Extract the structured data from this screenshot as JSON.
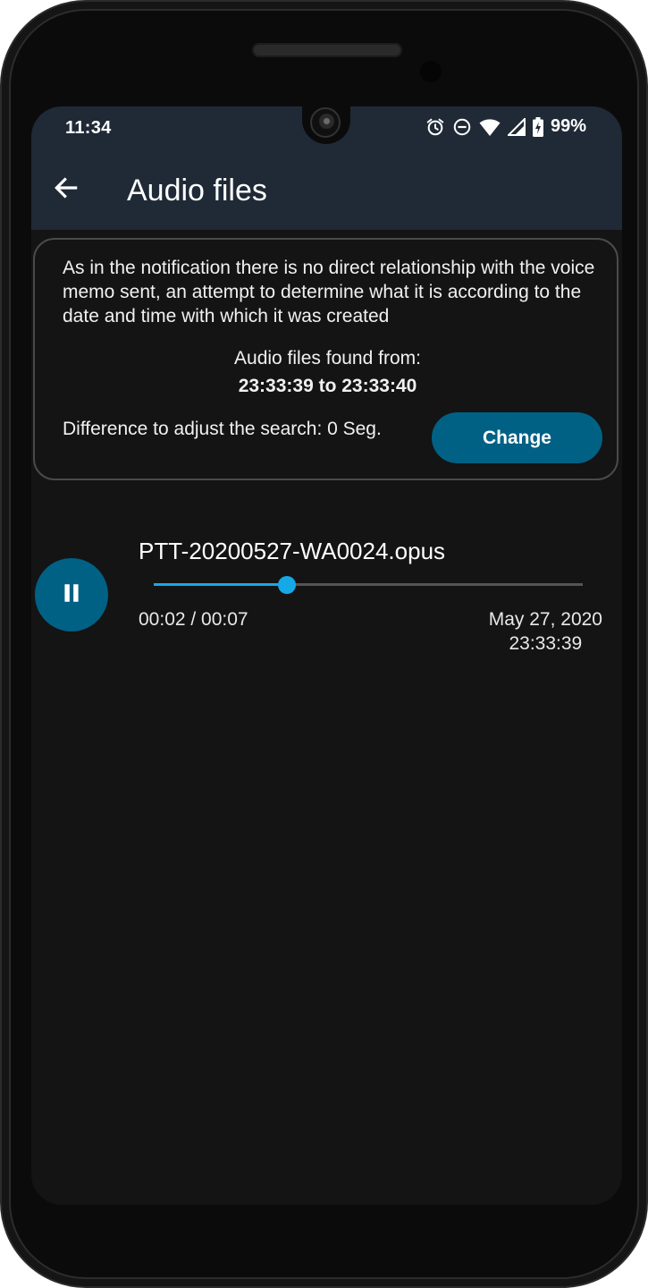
{
  "status_bar": {
    "time": "11:34",
    "battery_percent": "99%"
  },
  "app_bar": {
    "title": "Audio files"
  },
  "info_card": {
    "description": "As in the notification there is no direct relationship with the voice memo sent, an attempt to determine what it is according to the date and time with which it was created",
    "found_label": "Audio files found from:",
    "found_range": "23:33:39 to 23:33:40",
    "difference_text": "Difference to adjust the search: 0 Seg.",
    "change_button_label": "Change"
  },
  "audio_items": [
    {
      "file_name": "PTT-20200527-WA0024.opus",
      "time_progress": "00:02 / 00:07",
      "date": "May 27, 2020",
      "time": "23:33:39",
      "progress_fraction": 0.31,
      "state": "playing"
    }
  ],
  "colors": {
    "appbar": "#1f2a36",
    "background": "#141414",
    "button": "#006185",
    "accent": "#15a9e8"
  },
  "icons": {
    "back": "arrow-left-icon",
    "play_pause": "pause-icon",
    "alarm": "alarm-icon",
    "dnd": "do-not-disturb-icon",
    "wifi": "wifi-icon",
    "signal": "signal-icon",
    "battery": "battery-charging-icon"
  }
}
